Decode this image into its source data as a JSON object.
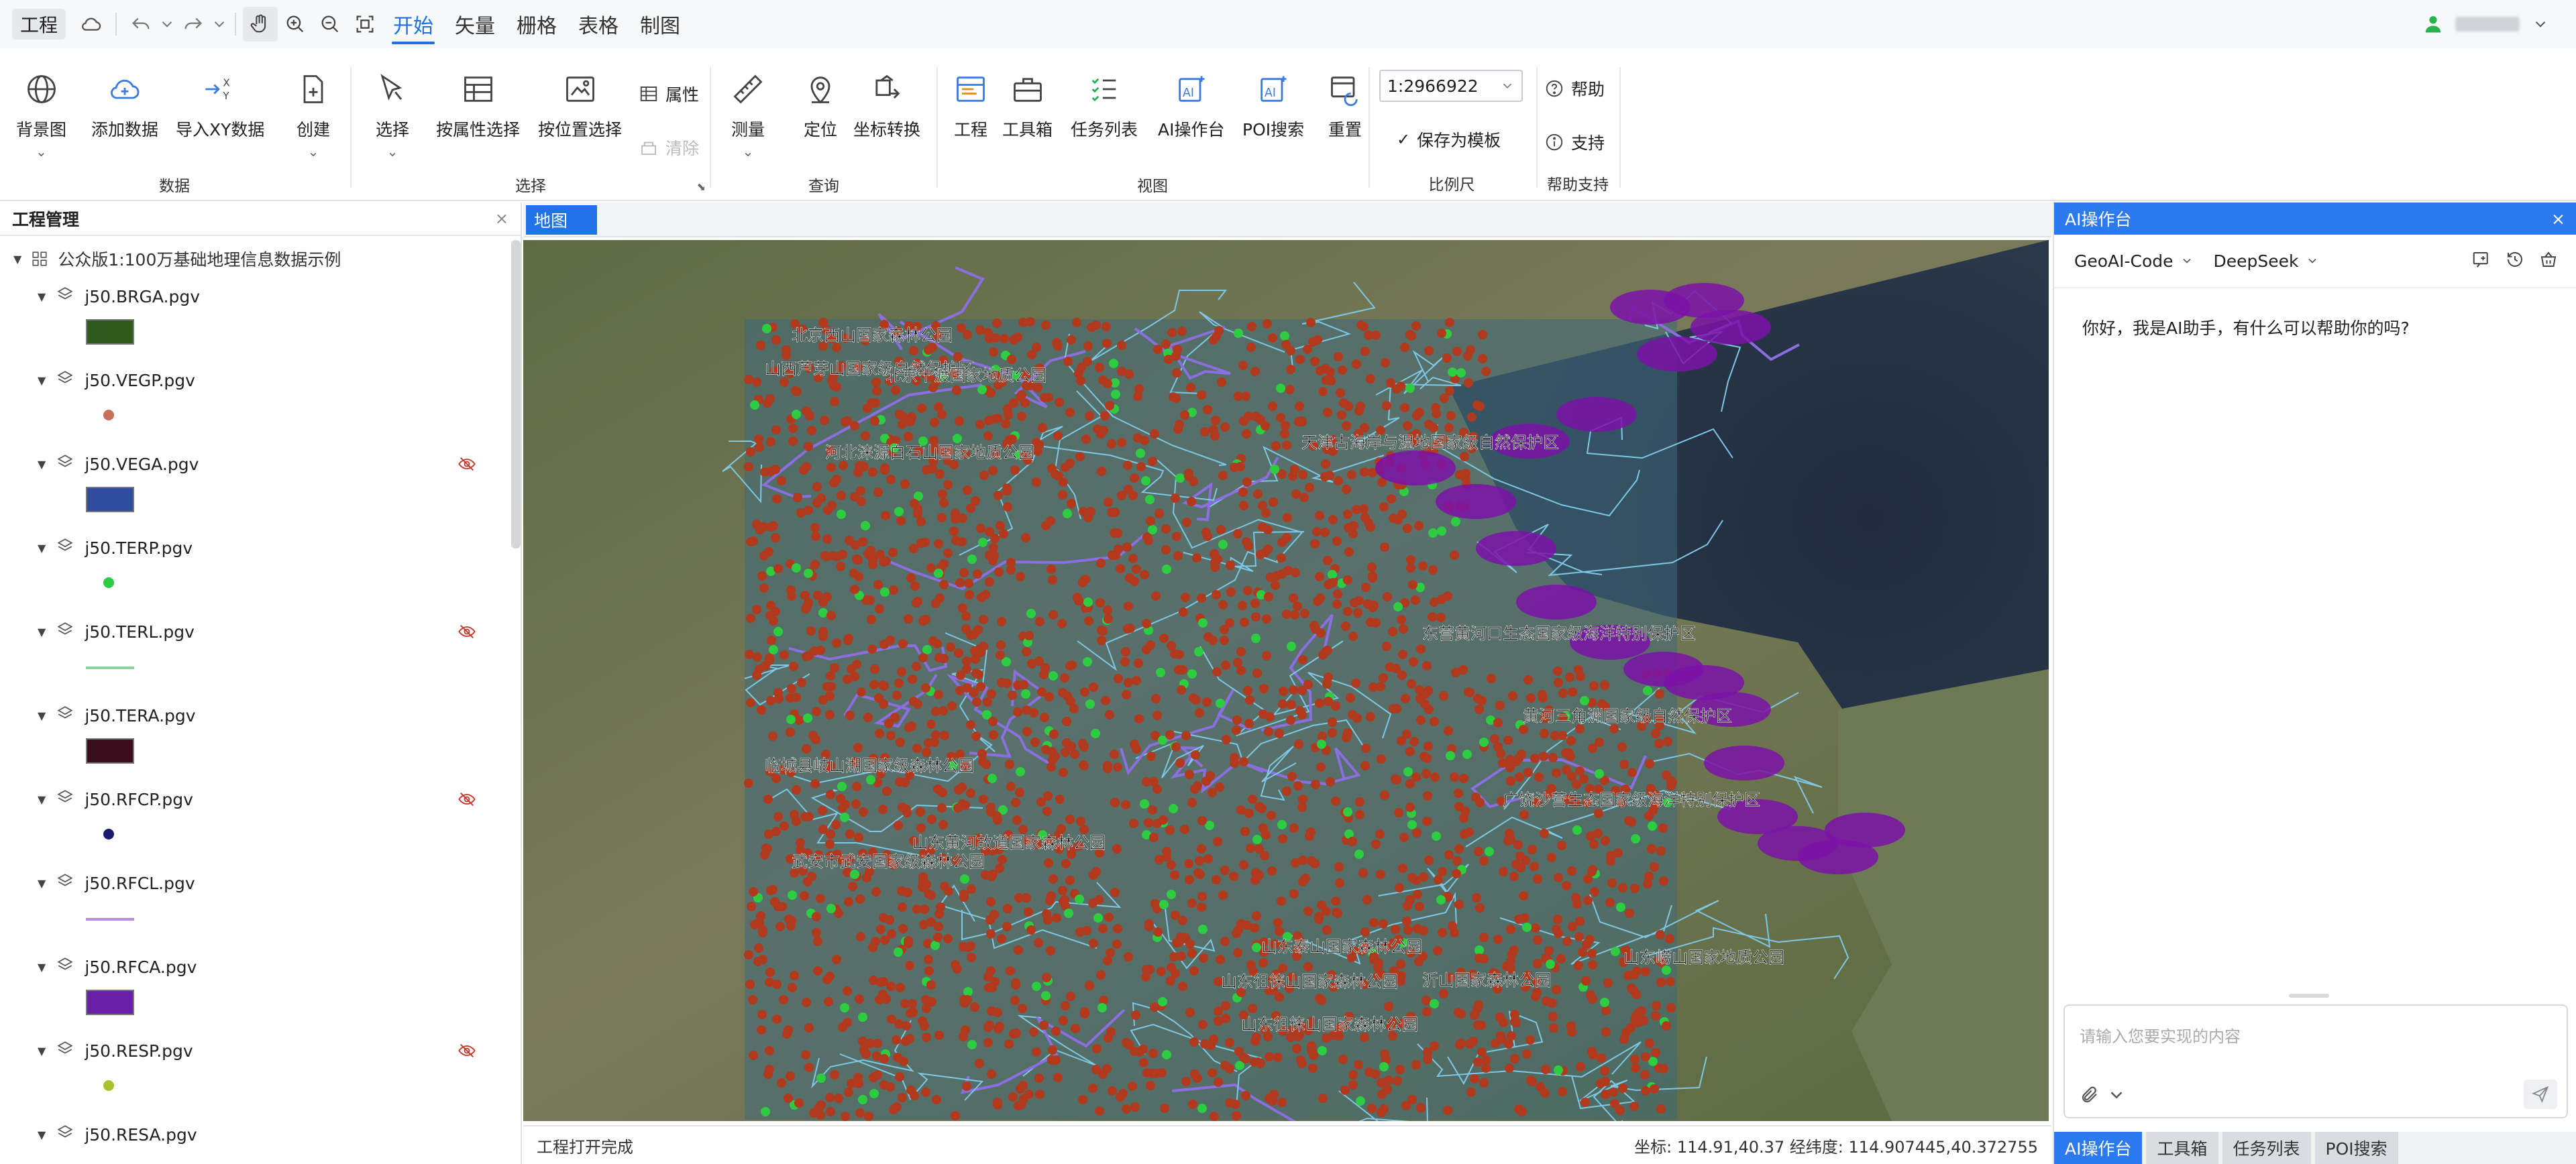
{
  "menubar": {
    "project_label": "工程",
    "tabs": [
      {
        "label": "开始",
        "active": true
      },
      {
        "label": "矢量",
        "active": false
      },
      {
        "label": "栅格",
        "active": false
      },
      {
        "label": "表格",
        "active": false
      },
      {
        "label": "制图",
        "active": false
      }
    ],
    "accent_color": "#1f6fe0"
  },
  "ribbon": {
    "data_group": {
      "label": "数据",
      "buttons": [
        "背景图",
        "添加数据",
        "导入XY数据",
        "创建"
      ]
    },
    "select_group": {
      "label": "选择",
      "buttons": [
        "选择",
        "按属性选择",
        "按位置选择"
      ],
      "small": [
        "属性",
        "清除"
      ]
    },
    "query_group": {
      "label": "查询",
      "buttons": [
        "测量",
        "定位",
        "坐标转换"
      ]
    },
    "view_group": {
      "label": "视图",
      "buttons": [
        "工程",
        "工具箱",
        "任务列表",
        "AI操作台",
        "POI搜索",
        "重置"
      ]
    },
    "scale_group": {
      "label": "比例尺",
      "scale_value": "1:2966922",
      "save_template": "保存为模板"
    },
    "help_group": {
      "label": "帮助支持",
      "help": "帮助",
      "support": "支持"
    }
  },
  "project_panel": {
    "title": "工程管理",
    "root": "公众版1:100万基础地理信息数据示例",
    "layers": [
      {
        "name": "j50.BRGA.pgv",
        "hidden": false,
        "symbol": "fill",
        "color": "#2f5a1e"
      },
      {
        "name": "j50.VEGP.pgv",
        "hidden": false,
        "symbol": "point",
        "color": "#c8705a"
      },
      {
        "name": "j50.VEGA.pgv",
        "hidden": true,
        "symbol": "fill",
        "color": "#2f4d9c"
      },
      {
        "name": "j50.TERP.pgv",
        "hidden": false,
        "symbol": "point",
        "color": "#2ecc40"
      },
      {
        "name": "j50.TERL.pgv",
        "hidden": true,
        "symbol": "line",
        "color": "#8fd19e"
      },
      {
        "name": "j50.TERA.pgv",
        "hidden": false,
        "symbol": "fill",
        "color": "#3a0e1c"
      },
      {
        "name": "j50.RFCP.pgv",
        "hidden": true,
        "symbol": "point",
        "color": "#1c1a6e"
      },
      {
        "name": "j50.RFCL.pgv",
        "hidden": false,
        "symbol": "line",
        "color": "#b58cf0"
      },
      {
        "name": "j50.RFCA.pgv",
        "hidden": false,
        "symbol": "fill",
        "color": "#6a1fa8"
      },
      {
        "name": "j50.RESP.pgv",
        "hidden": true,
        "symbol": "point",
        "color": "#a8c22a"
      },
      {
        "name": "j50.RESA.pgv",
        "hidden": false,
        "symbol": "none",
        "color": ""
      }
    ]
  },
  "map": {
    "tab_label": "地图",
    "labels": [
      "北京西山国家森林公园",
      "山西芦芽山国家级自然保护区",
      "北京十渡国家地质公园",
      "河北涞源白石山国家地质公园",
      "天津古海岸与湿地国家级自然保护区",
      "东营黄河口生态国家级海洋特别保护区",
      "黄河三角洲国家级自然保护区",
      "临城县岐山湖国家级森林公园",
      "广饶沙营生态国家级海洋特别保护区",
      "山东黄河故道国家森林公园",
      "武安市武安国家级森林公园",
      "山东泰山国家森林公园",
      "山东崂山国家地质公园",
      "山东徂徕山国家森林公园",
      "沂山国家森林公园",
      "山东徂徕山国家森林公园"
    ]
  },
  "status": {
    "message": "工程打开完成",
    "coords": "坐标: 114.91,40.37 经纬度: 114.907445,40.372755"
  },
  "ai_panel": {
    "title": "AI操作台",
    "engine": "GeoAI-Code",
    "model": "DeepSeek",
    "greeting": "你好，我是AI助手，有什么可以帮助你的吗?",
    "input_placeholder": "请输入您要实现的内容",
    "bottom_tabs": [
      {
        "label": "AI操作台",
        "active": true
      },
      {
        "label": "工具箱",
        "active": false
      },
      {
        "label": "任务列表",
        "active": false
      },
      {
        "label": "POI搜索",
        "active": false
      }
    ]
  }
}
